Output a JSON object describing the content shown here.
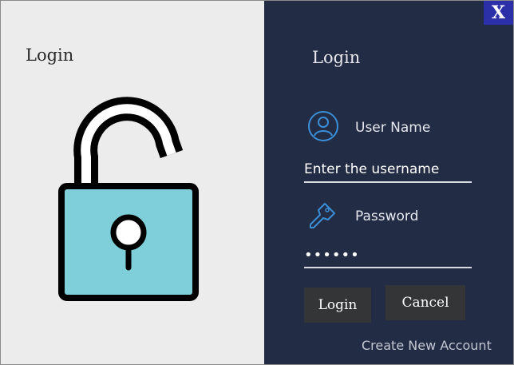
{
  "brand_panel": {
    "title": "Login",
    "illustration_icon": "unlocked-padlock-icon"
  },
  "window": {
    "close_label": "X"
  },
  "form": {
    "title": "Login",
    "username": {
      "icon": "user-icon",
      "label": "User Name",
      "placeholder": "Enter the username",
      "value": ""
    },
    "password": {
      "icon": "key-icon",
      "label": "Password",
      "value": "••••••"
    },
    "login_button": "Login",
    "cancel_button": "Cancel",
    "create_account_link": "Create New Account"
  },
  "colors": {
    "left_background": "#ececec",
    "right_background": "#222c44",
    "close_button": "#2b2fa8",
    "button_background": "#343536",
    "lock_body": "#7ecfd9",
    "icon_blue": "#3a8fd6"
  }
}
